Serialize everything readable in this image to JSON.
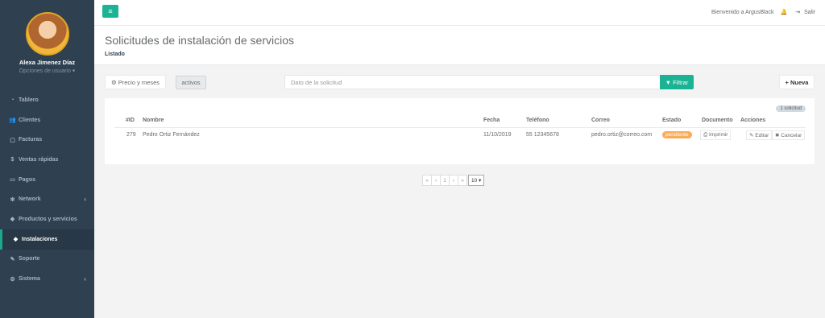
{
  "sidebar": {
    "user_name": "Alexa Jimenez Díaz",
    "user_options": "Opciones de usuario ▾",
    "items": [
      {
        "label": "Tablero",
        "icon": "dashboard-icon",
        "glyph": "◔"
      },
      {
        "label": "Clientes",
        "icon": "users-icon",
        "glyph": "👥"
      },
      {
        "label": "Facturas",
        "icon": "file-icon",
        "glyph": "▢"
      },
      {
        "label": "Ventas rápidas",
        "icon": "dollar-icon",
        "glyph": "$"
      },
      {
        "label": "Pagos",
        "icon": "money-icon",
        "glyph": "▭"
      },
      {
        "label": "Network",
        "icon": "network-icon",
        "glyph": "✻",
        "has_arrow": true
      },
      {
        "label": "Productos y servicios",
        "icon": "tag-icon",
        "glyph": "◆"
      },
      {
        "label": "Instalaciones",
        "icon": "tag-icon",
        "glyph": "◆",
        "active": true
      },
      {
        "label": "Soporte",
        "icon": "wrench-icon",
        "glyph": "✎"
      },
      {
        "label": "Sistema",
        "icon": "cogs-icon",
        "glyph": "⚙",
        "has_arrow": true
      }
    ],
    "arrow_glyph": "‹"
  },
  "topbar": {
    "menu_glyph": "≡",
    "welcome": "Bienvenido a ArgusBlack",
    "bell_glyph": "🔔",
    "logout_glyph": "⇥",
    "logout": "Salir"
  },
  "heading": {
    "title": "Solicitudes de instalación de servicios",
    "breadcrumb": "Listado"
  },
  "toolbar": {
    "price_button": "⚙ Precio y meses",
    "active_filter": "activos",
    "search_placeholder": "Dato de la solicitud",
    "filter_button": "▼ Filtrar",
    "new_button": "+ Nueva"
  },
  "table": {
    "count_badge": "1 solicitud",
    "columns": [
      "#ID",
      "Nombre",
      "Fecha",
      "Teléfono",
      "Correo",
      "Estado",
      "Documento",
      "Acciones"
    ],
    "rows": [
      {
        "id": "279",
        "name": "Pedro Ortiz Fernández",
        "date": "11/10/2019",
        "phone": "55 12345678",
        "email": "pedro.ortiz@correo.com",
        "status": "pendiente",
        "print": "⎙ Imprimir",
        "edit": "✎ Editar",
        "cancel": "✖ Cancelar"
      }
    ]
  },
  "pagination": {
    "first": "«",
    "prev": "‹",
    "page": "1",
    "next": "›",
    "last": "»",
    "per_page": "10 ▾"
  },
  "colors": {
    "sidebar_bg": "#2f4050",
    "accent": "#1ab394",
    "warning": "#f8ac59"
  }
}
